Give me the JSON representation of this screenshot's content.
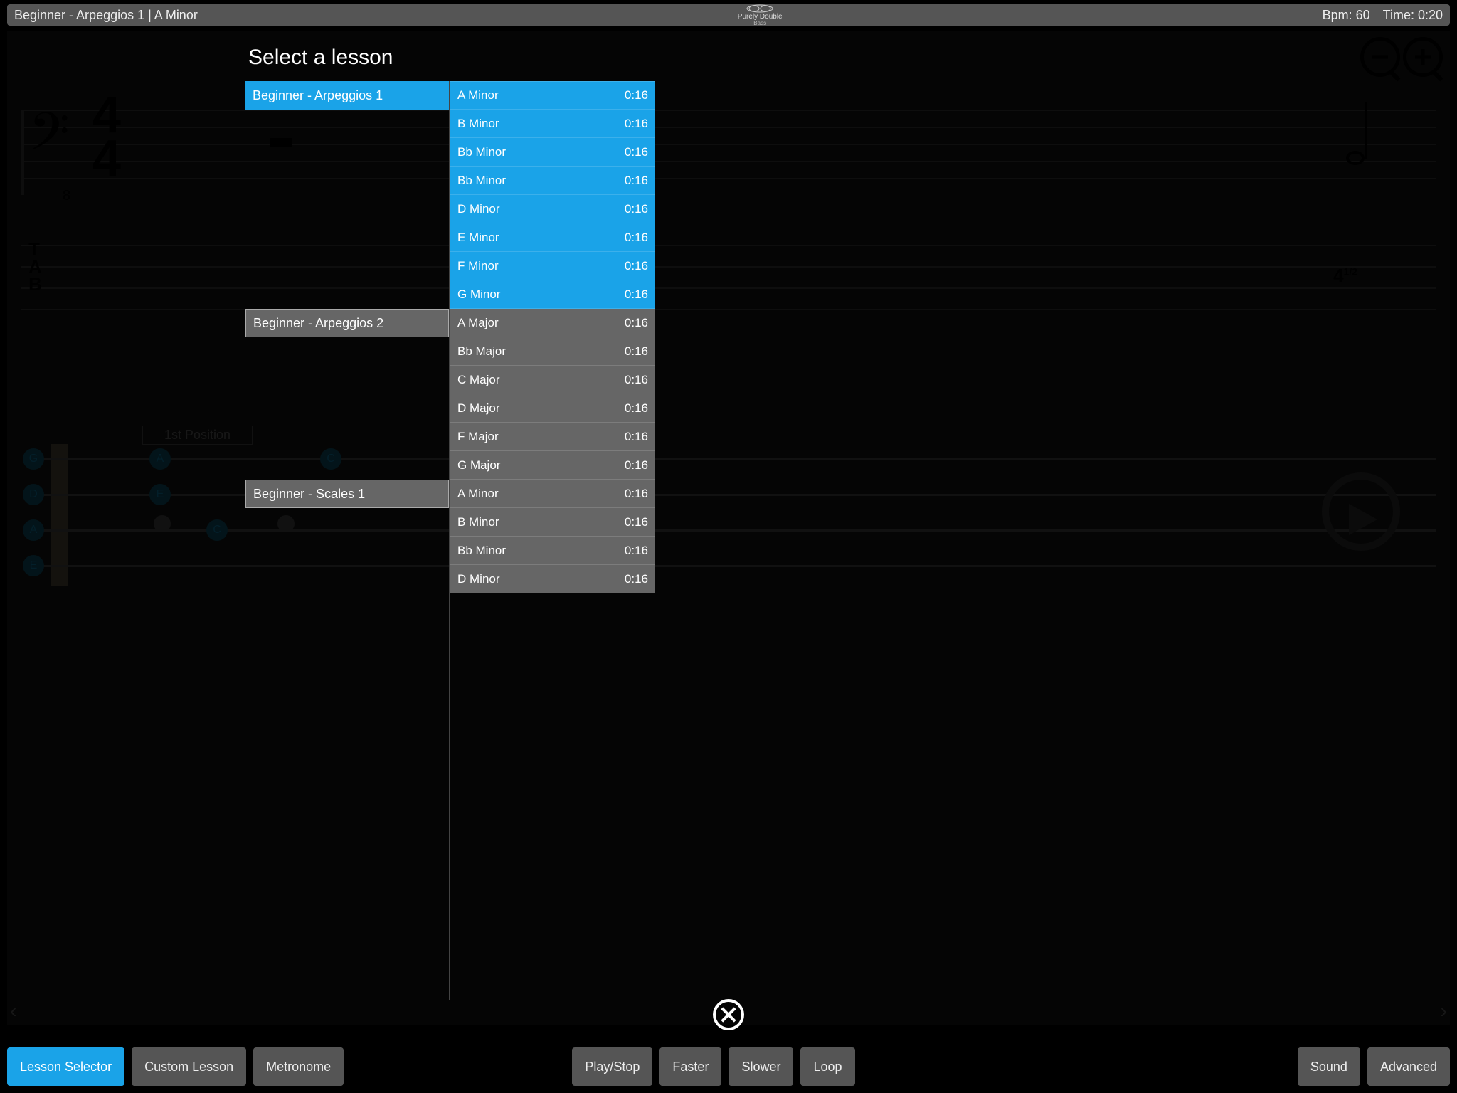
{
  "header": {
    "title": "Beginner - Arpeggios 1  |  A Minor",
    "logo_top": "Purely Double",
    "logo_bottom": "Bass",
    "bpm": "Bpm: 60",
    "time": "Time: 0:20"
  },
  "bg": {
    "clef": "𝄢",
    "ts_top": "4",
    "ts_bot": "4",
    "sub8": "8",
    "tab_label_t": "T",
    "tab_label_a": "A",
    "tab_label_b": "B",
    "fret_num": "4",
    "fret_sup": "1/2",
    "position_label": "1st Position",
    "open_g": "G",
    "open_d": "D",
    "open_a": "A",
    "open_e": "E",
    "dot_a": "A",
    "dot_e": "E",
    "dot_c": "C",
    "dot_c2": "C",
    "pager_left": "‹",
    "pager_right": "›"
  },
  "panel": {
    "title": "Select a lesson",
    "groups": [
      {
        "label": "Beginner - Arpeggios 1",
        "selected": true,
        "items": [
          {
            "name": "A Minor",
            "dur": "0:16"
          },
          {
            "name": "B Minor",
            "dur": "0:16"
          },
          {
            "name": "Bb Minor",
            "dur": "0:16"
          },
          {
            "name": "Bb Minor",
            "dur": "0:16"
          },
          {
            "name": "D Minor",
            "dur": "0:16"
          },
          {
            "name": "E Minor",
            "dur": "0:16"
          },
          {
            "name": "F Minor",
            "dur": "0:16"
          },
          {
            "name": "G Minor",
            "dur": "0:16"
          }
        ]
      },
      {
        "label": "Beginner - Arpeggios 2",
        "selected": false,
        "items": [
          {
            "name": "A Major",
            "dur": "0:16"
          },
          {
            "name": "Bb Major",
            "dur": "0:16"
          },
          {
            "name": "C Major",
            "dur": "0:16"
          },
          {
            "name": "D Major",
            "dur": "0:16"
          },
          {
            "name": "F Major",
            "dur": "0:16"
          },
          {
            "name": "G Major",
            "dur": "0:16"
          }
        ]
      },
      {
        "label": "Beginner - Scales 1",
        "selected": false,
        "items": [
          {
            "name": "A Minor",
            "dur": "0:16"
          },
          {
            "name": "B Minor",
            "dur": "0:16"
          },
          {
            "name": "Bb Minor",
            "dur": "0:16"
          },
          {
            "name": "D Minor",
            "dur": "0:16"
          }
        ]
      }
    ]
  },
  "toolbar": {
    "lesson_selector": "Lesson Selector",
    "custom_lesson": "Custom Lesson",
    "metronome": "Metronome",
    "play_stop": "Play/Stop",
    "faster": "Faster",
    "slower": "Slower",
    "loop": "Loop",
    "sound": "Sound",
    "advanced": "Advanced"
  }
}
